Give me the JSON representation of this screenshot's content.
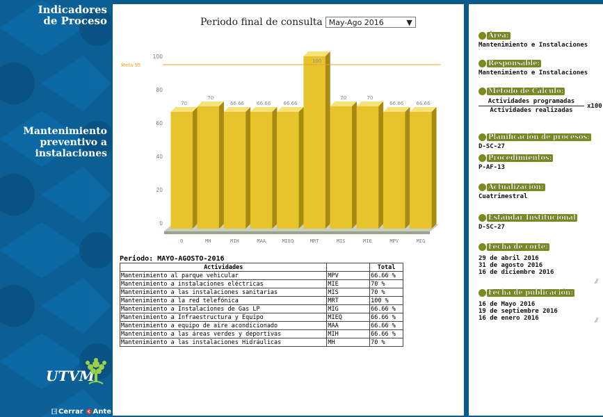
{
  "sidebar": {
    "title_line1": "Indicadores",
    "title_line2": "de Proceso",
    "indicator_line1": "Mantenimiento",
    "indicator_line2": "preventivo a",
    "indicator_line3": "instalaciones",
    "logo_text": "UTVM",
    "close_label": "Cerrar",
    "back_label": "Anterior"
  },
  "header": {
    "period_label": "Periodo final de consulta",
    "period_selected": "May-Ago 2016"
  },
  "chart_data": {
    "type": "bar",
    "categories": [
      "0",
      "MH",
      "MIH",
      "MAA",
      "MIEQ",
      "MRT",
      "MIS",
      "MIE",
      "MPV",
      "MIG"
    ],
    "values": [
      66.66,
      70,
      66.66,
      66.66,
      66.66,
      100,
      70,
      70,
      66.66,
      66.66
    ],
    "data_labels": [
      "",
      "70",
      "70",
      "66.66",
      "66.66",
      "66.66",
      "100",
      "70",
      "70",
      "66.66",
      "66.66"
    ],
    "ylim": [
      0,
      100
    ],
    "yticks": [
      0,
      20,
      40,
      60,
      80,
      100
    ],
    "goal_label": "Meta 95",
    "goal_value": 95,
    "colors": {
      "bar": "#e8c42c",
      "bar_dark": "#a88a10",
      "goal": "#f0a020",
      "floor": "#c8d0c0"
    }
  },
  "table": {
    "period_text": "Periodo: MAYO-AGOSTO-2016",
    "headers": [
      "Actividades",
      "",
      "Total"
    ],
    "rows": [
      [
        "Mantenimiento al parque vehicular",
        "MPV",
        "66.66 %"
      ],
      [
        "Mantenimiento a instalaciones eléctricas",
        "MIE",
        "70 %"
      ],
      [
        "Mantenimiento a las instalaciones sanitarias",
        "MIS",
        "70 %"
      ],
      [
        "Mantenimiento a la red telefónica",
        "MRT",
        "100 %"
      ],
      [
        "Mantenimiento a Instalaciones de Gas LP",
        "MIG",
        "66.66 %"
      ],
      [
        "Mantenimiento a Infraestructura y Equipo",
        "MIEQ",
        "66.66 %"
      ],
      [
        "Mantenimiento a equipo de aire acondicionado",
        "MAA",
        "66.66 %"
      ],
      [
        "Mantenimiento a las áreas verdes y deportivas",
        "MIH",
        "66.66 %"
      ],
      [
        "Mantenimiento a las instalaciones Hidráulicas",
        "MH",
        "70 %"
      ]
    ]
  },
  "info": {
    "area_label": "Área:",
    "area_value": "Mantenimiento e Instalaciones",
    "responsable_label": "Responsable:",
    "responsable_value": "Mantenimiento e Instalaciones",
    "metodo_label": "Método de Cálculo:",
    "metodo_num": "Actividades programadas",
    "metodo_den": "Actividades realizadas",
    "metodo_factor": "x100",
    "planificacion_label": "Planificación de procesos:",
    "planificacion_value": "D-SC-27",
    "procedimientos_label": "Procedimientos:",
    "procedimientos_value": "P-AF-13",
    "actualizacion_label": "Actualización:",
    "actualizacion_value": "Cuatrimestral",
    "estandar_label": "Estándar Institucional",
    "estandar_value": "D-SC-27",
    "corte_label": "Fecha de corte:",
    "corte_values": [
      "29 de abril 2016",
      "31 de agosto 2016",
      "16 de diciembre 2016"
    ],
    "publicacion_label": "Fecha de publicación:",
    "publicacion_values": [
      "16 de Mayo 2016",
      "19 de septiembre 2016",
      "16 de enero 2016"
    ]
  }
}
